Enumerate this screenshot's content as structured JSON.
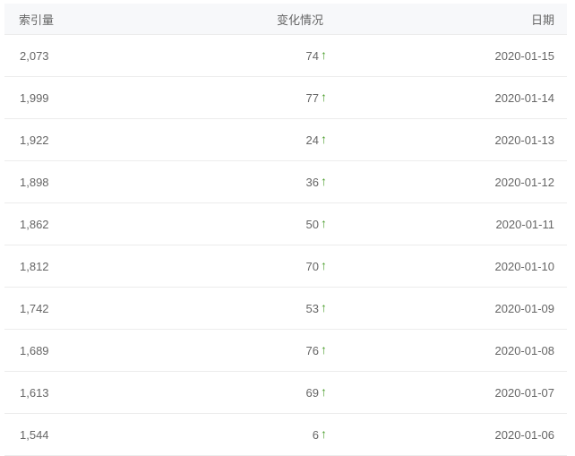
{
  "table": {
    "headers": {
      "index": "索引量",
      "change": "变化情况",
      "date": "日期"
    },
    "rows": [
      {
        "index": "2,073",
        "change": "74",
        "trend": "up",
        "date": "2020-01-15"
      },
      {
        "index": "1,999",
        "change": "77",
        "trend": "up",
        "date": "2020-01-14"
      },
      {
        "index": "1,922",
        "change": "24",
        "trend": "up",
        "date": "2020-01-13"
      },
      {
        "index": "1,898",
        "change": "36",
        "trend": "up",
        "date": "2020-01-12"
      },
      {
        "index": "1,862",
        "change": "50",
        "trend": "up",
        "date": "2020-01-11"
      },
      {
        "index": "1,812",
        "change": "70",
        "trend": "up",
        "date": "2020-01-10"
      },
      {
        "index": "1,742",
        "change": "53",
        "trend": "up",
        "date": "2020-01-09"
      },
      {
        "index": "1,689",
        "change": "76",
        "trend": "up",
        "date": "2020-01-08"
      },
      {
        "index": "1,613",
        "change": "69",
        "trend": "up",
        "date": "2020-01-07"
      },
      {
        "index": "1,544",
        "change": "6",
        "trend": "up",
        "date": "2020-01-06"
      }
    ]
  },
  "colors": {
    "up_arrow": "#4a9d2b",
    "header_bg": "#f7f8fa",
    "text": "#666666",
    "divider": "#ececec"
  },
  "icons": {
    "trend_up": "arrow-up-icon"
  }
}
